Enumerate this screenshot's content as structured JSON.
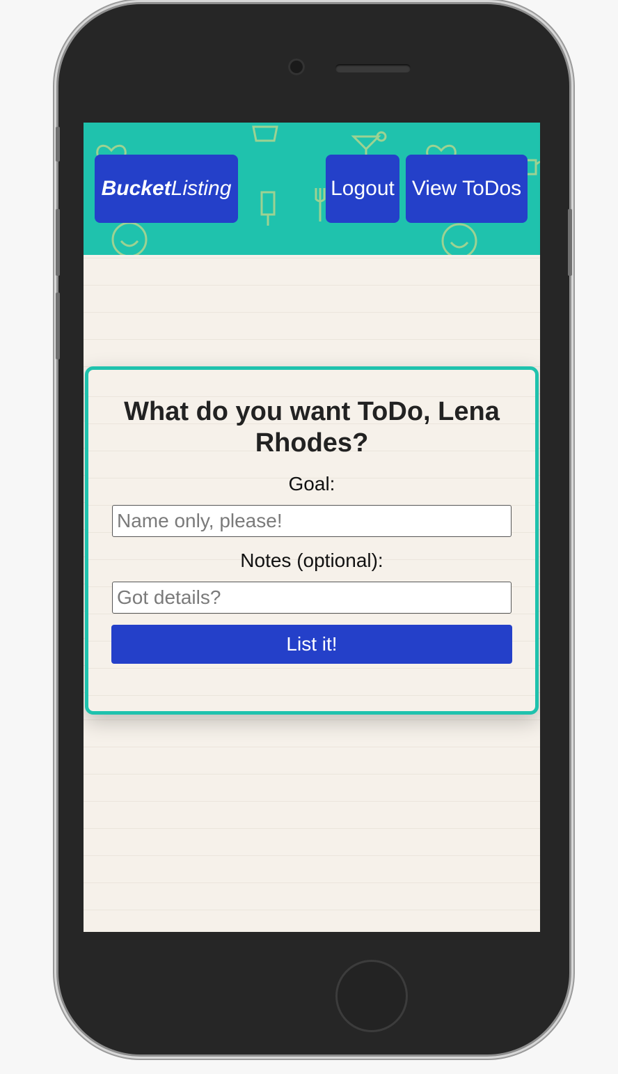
{
  "header": {
    "brand_bold": "Bucket",
    "brand_italic": "Listing",
    "logout_label": "Logout",
    "view_todos_label": "View ToDos",
    "background_color": "#1fc2ad",
    "button_color": "#2440c9"
  },
  "form": {
    "title": "What do you want ToDo, Lena Rhodes?",
    "goal_label": "Goal:",
    "goal_placeholder": "Name only, please!",
    "goal_value": "",
    "notes_label": "Notes (optional):",
    "notes_placeholder": "Got details?",
    "notes_value": "",
    "submit_label": "List it!",
    "border_color": "#1fc2ad"
  },
  "icons": [
    "heart-icon",
    "ice-cream-icon",
    "cocktail-icon",
    "smiley-icon",
    "popsicle-icon",
    "fork-icon",
    "teapot-icon"
  ]
}
